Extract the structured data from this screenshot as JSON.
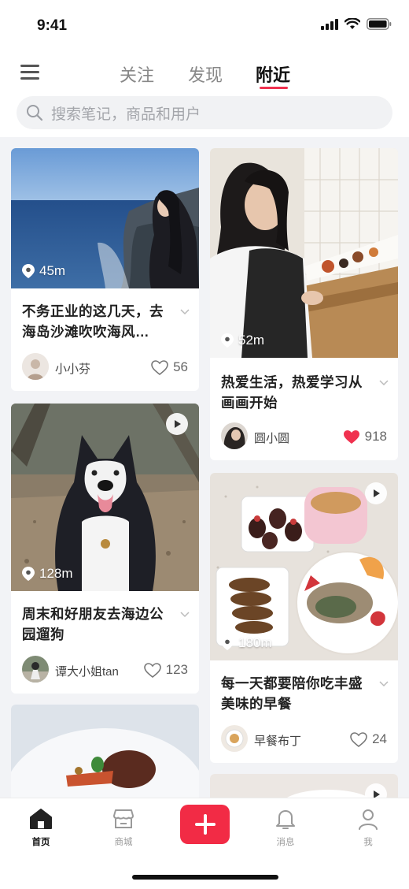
{
  "status_bar": {
    "time": "9:41"
  },
  "top_nav": {
    "tabs": [
      {
        "label": "关注",
        "active": false
      },
      {
        "label": "发现",
        "active": false
      },
      {
        "label": "附近",
        "active": true
      }
    ],
    "accent_color": "#f0314f"
  },
  "search": {
    "placeholder": "搜索笔记，商品和用户"
  },
  "feed": {
    "cards": [
      {
        "distance": "45m",
        "title": "不务正业的这几天，去海岛沙滩吹吹海风…",
        "user": "小小芬",
        "likes": "56",
        "liked": false,
        "video": false
      },
      {
        "distance": "52m",
        "title": "热爱生活，热爱学习从画画开始",
        "user": "圆小圆",
        "likes": "918",
        "liked": true,
        "video": false
      },
      {
        "distance": "128m",
        "title": "周末和好朋友去海边公园遛狗",
        "user": "谭大小姐tan",
        "likes": "123",
        "liked": false,
        "video": true
      },
      {
        "distance": "180m",
        "title": "每一天都要陪你吃丰盛美味的早餐",
        "user": "早餐布丁",
        "likes": "24",
        "liked": false,
        "video": true
      }
    ]
  },
  "tab_bar": {
    "items": [
      {
        "label": "首页",
        "icon": "home-icon",
        "active": true
      },
      {
        "label": "商城",
        "icon": "store-icon",
        "active": false
      },
      {
        "label": "消息",
        "icon": "bell-icon",
        "active": false
      },
      {
        "label": "我",
        "icon": "profile-icon",
        "active": false
      }
    ],
    "add_color": "#f22b45"
  }
}
